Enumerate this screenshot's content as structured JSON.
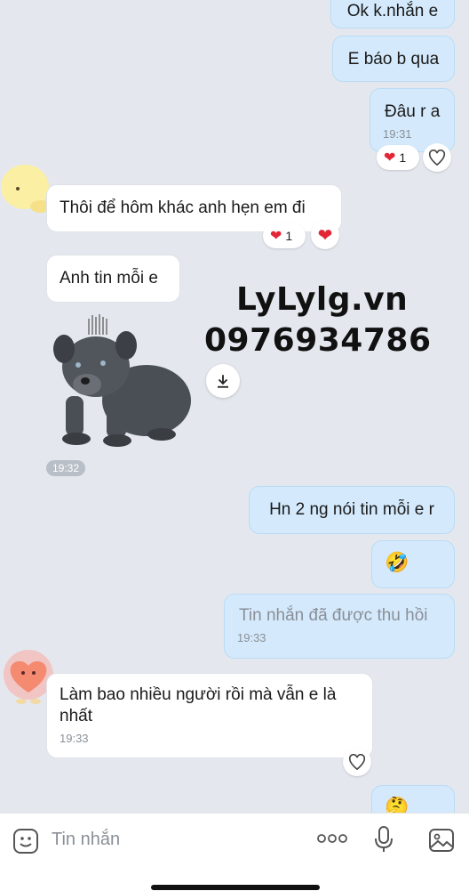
{
  "messages": {
    "m1": {
      "text": "Ok k.nhắn e"
    },
    "m2": {
      "text": "E báo b qua"
    },
    "m3": {
      "text": "Đâu r a",
      "time": "19:31",
      "reaction_count": "1"
    },
    "m4": {
      "text": "Thôi để hôm khác anh hẹn em đi",
      "reaction_count": "1"
    },
    "m5": {
      "text": "Anh tin mỗi e"
    },
    "sticker_time": "19:32",
    "m6": {
      "text": "Hn 2 ng nói tin mỗi e r"
    },
    "m7": {
      "emoji": "🤣"
    },
    "m8": {
      "text": "Tin nhắn đã được thu hồi",
      "time": "19:33"
    },
    "m9": {
      "text": "Làm bao nhiều người rồi mà vẫn e là nhất",
      "time": "19:33"
    },
    "m10": {
      "emoji": "🤔"
    }
  },
  "watermark": {
    "line1": "LyLylg.vn",
    "line2": "0976934786"
  },
  "input_bar": {
    "placeholder": "Tin nhắn"
  },
  "colors": {
    "outgoing_bubble": "#d4eafc",
    "incoming_bubble": "#ffffff",
    "background": "#e4e8ee",
    "heart": "#e32636"
  }
}
